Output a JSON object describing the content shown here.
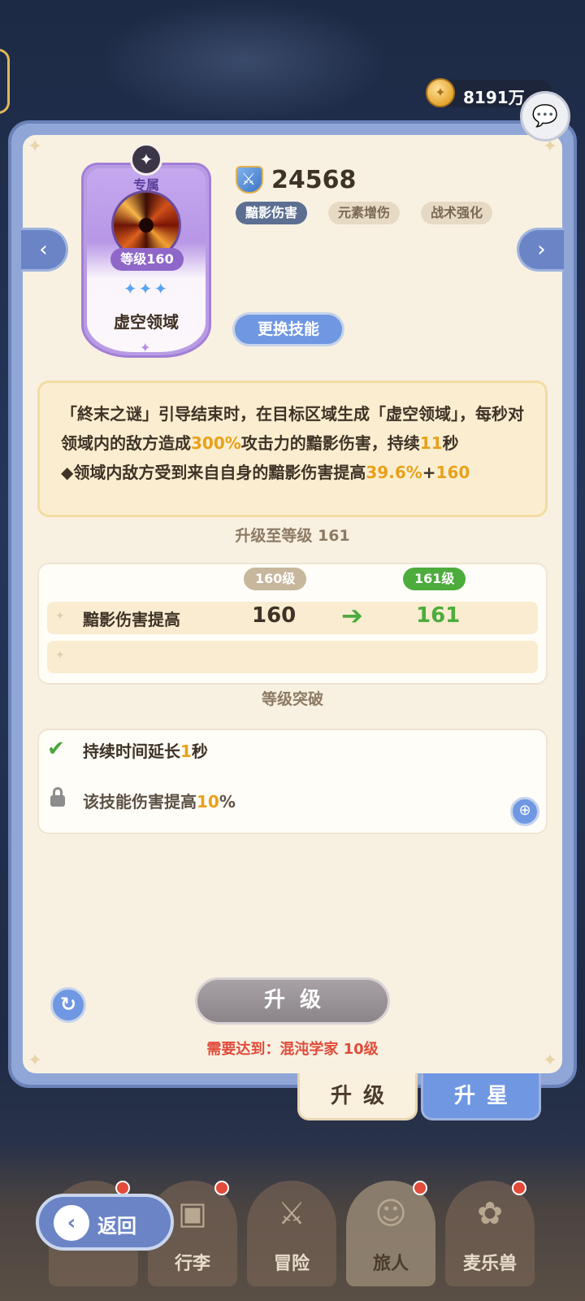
{
  "currency": {
    "icon": "coin-icon",
    "value": "8191万"
  },
  "skill": {
    "exclusive_label": "专属",
    "level_label": "等级160",
    "name": "虚空领域",
    "stars": "✦✦✦"
  },
  "power": {
    "value": "24568"
  },
  "tags": [
    "黯影伤害",
    "元素增伤",
    "战术强化"
  ],
  "change_skill_label": "更换技能",
  "description": {
    "line1_pre": "「終末之谜」引导结束时，在目标区域生成「虚空领域」，每秒对领域内的敌方造成",
    "line1_hl": "300%",
    "line1_mid": "攻击力的黯影伤害，持续",
    "line1_hl2": "11",
    "line1_post": "秒",
    "bullet_pre": "◆领域内敌方受到来自自身的黯影伤害提高",
    "bullet_hl": "39.6%",
    "bullet_mid": "+",
    "bullet_hl2": "160"
  },
  "upgrade": {
    "title": "升级至等级 161",
    "current_level_badge": "160级",
    "next_level_badge": "161级",
    "stat_label": "黯影伤害提高",
    "stat_current": "160",
    "stat_next": "161"
  },
  "breakthrough": {
    "title": "等级突破",
    "item1_pre": "持续时间延长",
    "item1_hl": "1",
    "item1_post": "秒",
    "item2_pre": "该技能伤害提高",
    "item2_hl": "10",
    "item2_post": "%"
  },
  "upgrade_button": "升级",
  "requirement": "需要达到：混沌学家  10级",
  "tabs": {
    "upgrade": "升级",
    "star": "升星"
  },
  "bottom_nav": [
    {
      "label": "",
      "icon": "crown-icon",
      "dot": true
    },
    {
      "label": "行李",
      "icon": "chest-icon",
      "dot": true
    },
    {
      "label": "冒险",
      "icon": "swords-icon",
      "dot": false
    },
    {
      "label": "旅人",
      "icon": "character-icon",
      "dot": true
    },
    {
      "label": "麦乐兽",
      "icon": "fox-icon",
      "dot": true
    }
  ],
  "back_button": "返回",
  "colors": {
    "accent_blue": "#6f97e2",
    "highlight_orange": "#e8a11b",
    "green": "#4cac3c",
    "warning_red": "#e14b3a"
  }
}
